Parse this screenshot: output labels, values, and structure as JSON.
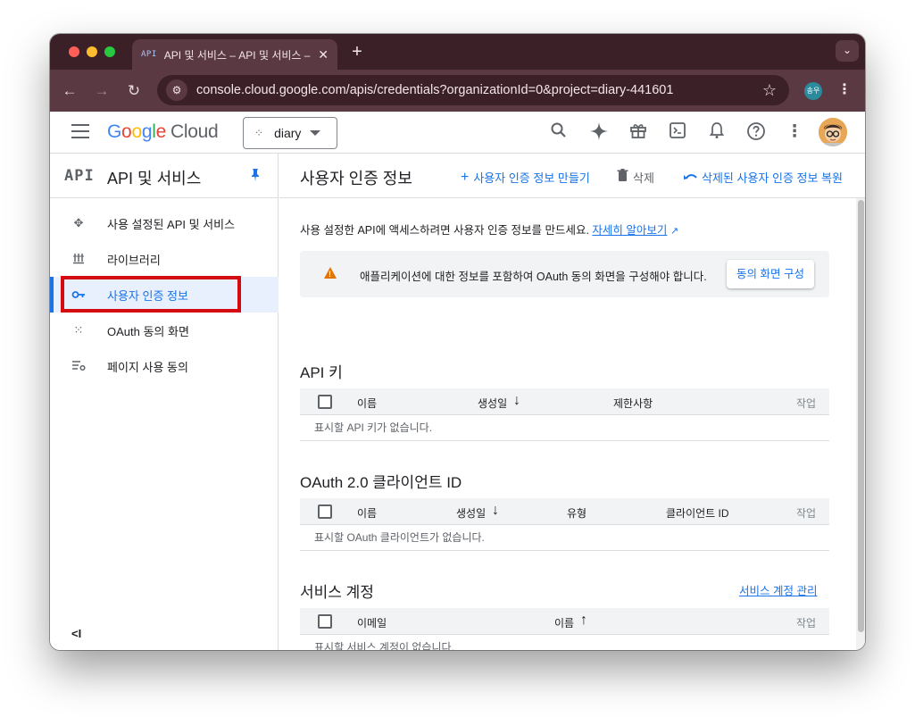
{
  "browser": {
    "tab": {
      "favicon_text": "API",
      "title": "API 및 서비스 – API 및 서비스 – G"
    },
    "url": "console.cloud.google.com/apis/credentials?organizationId=0&project=diary-441601",
    "profile_initials": "송우"
  },
  "header": {
    "logo": {
      "g1": "G",
      "o1": "o",
      "o2": "o",
      "g2": "g",
      "l": "l",
      "e": "e",
      "cloud": "Cloud"
    },
    "project_name": "diary"
  },
  "sidebar": {
    "logo_text": "API",
    "title": "API 및 서비스",
    "items": [
      {
        "label": "사용 설정된 API 및 서비스",
        "icon": "enabled-apis-icon",
        "active": false
      },
      {
        "label": "라이브러리",
        "icon": "library-icon",
        "active": false
      },
      {
        "label": "사용자 인증 정보",
        "icon": "key-icon",
        "active": true
      },
      {
        "label": "OAuth 동의 화면",
        "icon": "oauth-consent-icon",
        "active": false
      },
      {
        "label": "페이지 사용 동의",
        "icon": "page-usage-agreements-icon",
        "active": false
      }
    ],
    "collapse_glyph": "<I"
  },
  "main": {
    "title": "사용자 인증 정보",
    "actions": {
      "create": "사용자 인증 정보 만들기",
      "delete": "삭제",
      "restore": "삭제된 사용자 인증 정보 복원"
    },
    "intro_text": "사용 설정한 API에 액세스하려면 사용자 인증 정보를 만드세요.",
    "intro_link": "자세히 알아보기",
    "banner": {
      "text": "애플리케이션에 대한 정보를 포함하여 OAuth 동의 화면을 구성해야 합니다.",
      "button": "동의 화면 구성"
    },
    "api_keys": {
      "title": "API 키",
      "columns": [
        "이름",
        "생성일",
        "제한사항",
        "작업"
      ],
      "empty": "표시할 API 키가 없습니다."
    },
    "oauth_clients": {
      "title": "OAuth 2.0 클라이언트 ID",
      "columns": [
        "이름",
        "생성일",
        "유형",
        "클라이언트 ID",
        "작업"
      ],
      "empty": "표시할 OAuth 클라이언트가 없습니다."
    },
    "service_accounts": {
      "title": "서비스 계정",
      "manage_link": "서비스 계정 관리",
      "columns": [
        "이메일",
        "이름",
        "작업"
      ],
      "empty": "표시할 서비스 계정이 없습니다."
    }
  },
  "colors": {
    "accent_blue": "#1a73e8",
    "highlight_red": "#d40c12",
    "warning_orange": "#e37400",
    "browser_chrome": "#5a3943"
  }
}
